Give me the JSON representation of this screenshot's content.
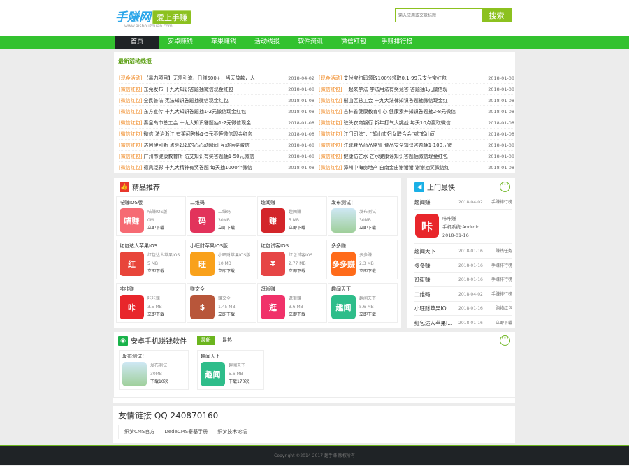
{
  "header": {
    "logo": "手赚网",
    "slogan": "爱上手赚",
    "domain": "www.aishouzhuan.com",
    "search_placeholder": "输入应用或文章标题",
    "search_button": "搜索"
  },
  "nav": [
    "首页",
    "安卓赚钱",
    "苹果赚钱",
    "活动线报",
    "软件资讯",
    "微信红包",
    "手赚排行榜"
  ],
  "news": {
    "title": "最新活动线报",
    "left": [
      [
        "[现金活动]",
        "【暴力项目】无需引流，日赚500+，当天放款，人",
        "2018-04-02"
      ],
      [
        "[微信红包]",
        "东莞发布 十九大知识答题抽微信现金红包",
        "2018-01-08"
      ],
      [
        "[微信红包]",
        "全民普法 宪法知识答题抽微信现金红包",
        "2018-01-08"
      ],
      [
        "[微信红包]",
        "东方宣传 十九大知识答题抽1-2元微信现金红包",
        "2018-01-08"
      ],
      [
        "[微信红包]",
        "秦皇岛市总工会 十九大知识答题抽1-2元微信现金",
        "2018-01-08"
      ],
      [
        "[微信红包]",
        "微信 法治浙江 有奖问答抽1-5元不等微信现金红包",
        "2018-01-08"
      ],
      [
        "[微信红包]",
        "达因伊可新 点亮妈妈的心心动瞬间 互动抽奖微信",
        "2018-01-08"
      ],
      [
        "[微信红包]",
        "广州市健康教育所 防艾知识有奖答题抽1-50元微信",
        "2018-01-08"
      ],
      [
        "[微信红包]",
        "德风泛彩 十九大精神有奖答题 每天抽1000个微信",
        "2018-01-08"
      ]
    ],
    "right": [
      [
        "[现金活动]",
        "支付宝扫码领取100%领取0.1-99元支付宝红包",
        "2018-01-08"
      ],
      [
        "[微信红包]",
        "一起来学法 学法用法有奖竞答 答题抽1元微信现",
        "2018-01-08"
      ],
      [
        "[微信红包]",
        "椒山区总工会 十九大法律知识答题抽微信现金红",
        "2018-01-08"
      ],
      [
        "[微信红包]",
        "吉林省健康教育中心 健康素养知识答题抽2-8元微信",
        "2018-01-08"
      ],
      [
        "[微信红包]",
        "驻头农商银行 新年打气大挑战 每天10点赢取微信",
        "2018-01-08"
      ],
      [
        "[微信红包]",
        "江门司法\"、\"鹤山市妇女联合会\"或\"鹤山司",
        "2018-01-08"
      ],
      [
        "[微信红包]",
        "江北食品药品监管 食品安全知识答题抽1-100元微",
        "2018-01-08"
      ],
      [
        "[微信红包]",
        "健康防芒水 芒水健康谣知识答题抽微信现金红包",
        "2018-01-08"
      ],
      [
        "[微信红包]",
        "漳州中海房地产 自南金由谢谢谢 谢谢抽奖微信红",
        "2018-01-08"
      ]
    ]
  },
  "recommend": {
    "title": "精品推荐",
    "items": [
      {
        "name": "喵赚IOS版",
        "sub": "喵赚IOS版",
        "size": "0M",
        "action": "立即下载",
        "icon": "喵赚",
        "color": "#f66a73"
      },
      {
        "name": "二维码",
        "sub": "二维码",
        "size": "30MB",
        "action": "立即下载",
        "icon": "码",
        "color": "#e2335b"
      },
      {
        "name": "趣闻赚",
        "sub": "趣闻赚",
        "size": "5 MB",
        "action": "立即下载",
        "icon": "赚",
        "color": "#d3252a"
      },
      {
        "name": "发布测试！",
        "sub": "发布测试！",
        "size": "30MB",
        "action": "立即下载",
        "icon": "",
        "color": "#9fcf9a"
      },
      {
        "name": "红包达人苹果IOS",
        "sub": "红包达人苹果IOS",
        "size": "5 MB",
        "action": "立即下载",
        "icon": "红",
        "color": "#e8453a"
      },
      {
        "name": "小旺财苹果IOS版",
        "sub": "小旺财苹果IOS版",
        "size": "10 MB",
        "action": "立即下载",
        "icon": "旺",
        "color": "#f9a11b"
      },
      {
        "name": "红包试客IOS",
        "sub": "红包试客IOS",
        "size": "2.77 MB",
        "action": "立即下载",
        "icon": "¥",
        "color": "#e64545"
      },
      {
        "name": "多多赚",
        "sub": "多多赚",
        "size": "2.3 MB",
        "action": "立即下载",
        "icon": "多多赚",
        "color": "#ff6b1a"
      },
      {
        "name": "咔咔赚",
        "sub": "咔咔赚",
        "size": "3.5 MB",
        "action": "立即下载",
        "icon": "咔",
        "color": "#e8262b"
      },
      {
        "name": "赚文全",
        "sub": "赚文全",
        "size": "1.45 MB",
        "action": "立即下载",
        "icon": "$",
        "color": "#b8563a"
      },
      {
        "name": "逛街赚",
        "sub": "逛街赚",
        "size": "3.6 MB",
        "action": "立即下载",
        "icon": "逛",
        "color": "#f0326a"
      },
      {
        "name": "趣闻天下",
        "sub": "趣闻天下",
        "size": "5.6 MB",
        "action": "立即下载",
        "icon": "趣闻",
        "color": "#2ebd8a"
      }
    ]
  },
  "sidebar": {
    "title": "上门最快",
    "top": {
      "name": "趣闻赚",
      "date": "2018-04-02",
      "cat": "手赚排行榜"
    },
    "feature": {
      "name": "咔咔赚",
      "system": "手机系统:Android",
      "date": "2018-01-16",
      "icon": "咔",
      "color": "#e8262b"
    },
    "rows": [
      [
        "趣闻天下",
        "2018-01-16",
        "赚钱任务"
      ],
      [
        "多多赚",
        "2018-01-16",
        "手赚排行榜"
      ],
      [
        "逛街赚",
        "2018-01-16",
        "手赚排行榜"
      ],
      [
        "二维码",
        "2018-04-02",
        "手赚排行榜"
      ],
      [
        "小旺财苹果IO...",
        "2018-01-16",
        "购物红包"
      ],
      [
        "红包达人苹果I...",
        "2018-01-16",
        "立即下载"
      ]
    ]
  },
  "android": {
    "title": "安卓手机赚钱软件",
    "tabs": [
      "最新",
      "最热"
    ],
    "items": [
      {
        "name": "发布测试！",
        "sub": "发布测试！",
        "size": "30MB",
        "action": "下载10次",
        "icon": "",
        "color": "#9fcf9a"
      },
      {
        "name": "趣闻天下",
        "sub": "趣闻天下",
        "size": "5.6 MB",
        "action": "下载170次",
        "icon": "趣闻",
        "color": "#2ebd8a"
      }
    ]
  },
  "links": {
    "title": "友情链接 QQ 240870160",
    "items": [
      "织梦CMS官方",
      "DedeCMS泰基手册",
      "织梦技术论坛"
    ]
  },
  "footer": "Copyright ©2014-2017 趣手赚 版权所有"
}
